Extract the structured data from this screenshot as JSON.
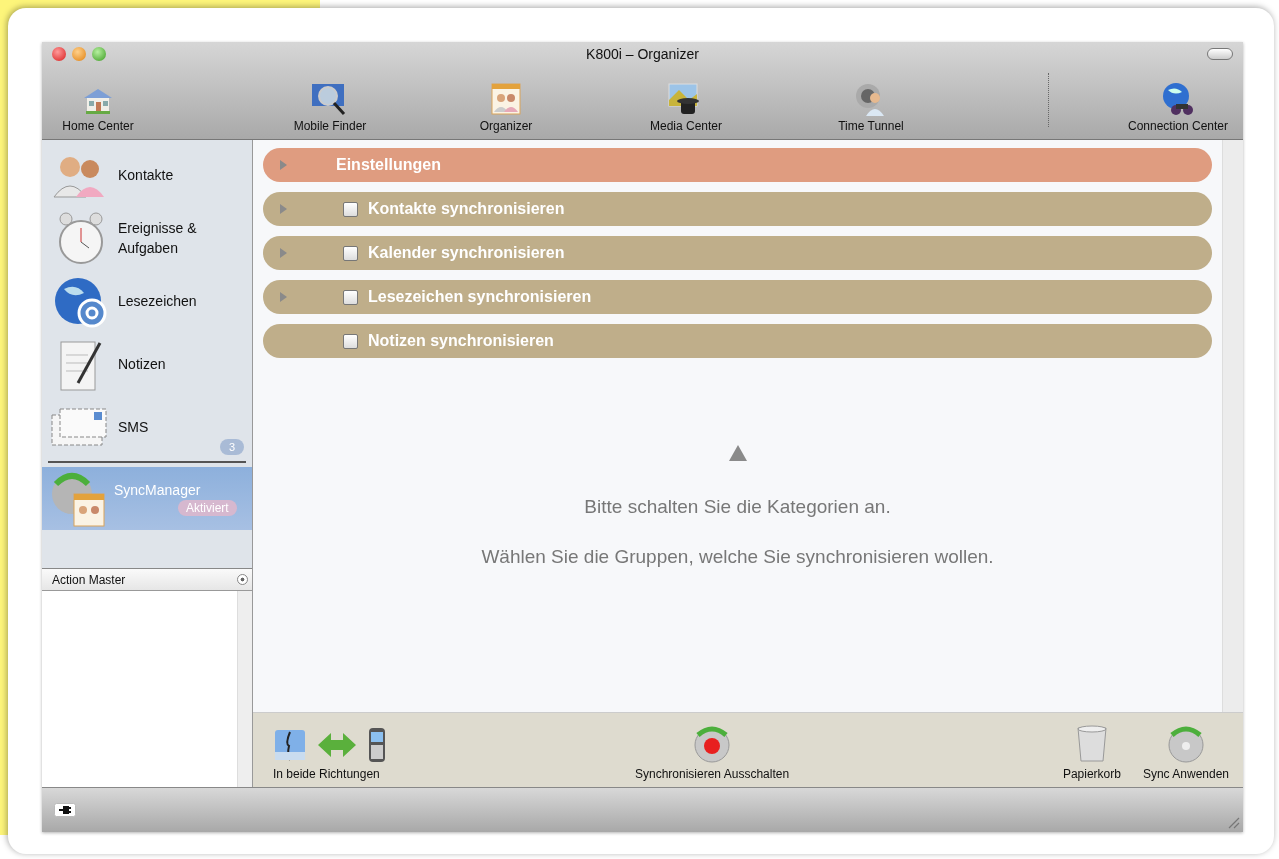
{
  "window": {
    "title": "K800i – Organizer"
  },
  "toolbar": [
    {
      "label": "Home Center",
      "kind": "home"
    },
    {
      "label": "Mobile Finder",
      "kind": "finder"
    },
    {
      "label": "Organizer",
      "kind": "organizer"
    },
    {
      "label": "Media Center",
      "kind": "media"
    },
    {
      "label": "Time Tunnel",
      "kind": "tunnel"
    },
    {
      "label": "Connection Center",
      "kind": "connection"
    }
  ],
  "sidebar": {
    "items": [
      {
        "label": "Kontakte",
        "kind": "contacts",
        "selected": false
      },
      {
        "label": "Ereignisse & Aufgaben",
        "kind": "clock",
        "selected": false
      },
      {
        "label": "Lesezeichen",
        "kind": "bookmarks",
        "selected": false
      },
      {
        "label": "Notizen",
        "kind": "notes",
        "selected": false
      },
      {
        "label": "SMS",
        "kind": "sms",
        "selected": false,
        "badge": "3"
      }
    ],
    "sync_item": {
      "label": "SyncManager",
      "status": "Aktiviert",
      "selected": true
    },
    "action_master": {
      "title": "Action Master"
    }
  },
  "sections": [
    {
      "label": "Einstellungen",
      "kind": "header",
      "expandable": true
    },
    {
      "label": "Kontakte synchronisieren",
      "kind": "category",
      "expandable": true,
      "checked": false
    },
    {
      "label": "Kalender synchronisieren",
      "kind": "category",
      "expandable": true,
      "checked": false
    },
    {
      "label": "Lesezeichen synchronisieren",
      "kind": "category",
      "expandable": true,
      "checked": false
    },
    {
      "label": "Notizen synchronisieren",
      "kind": "category",
      "expandable": false,
      "checked": false
    }
  ],
  "hint": {
    "lines": [
      "Bitte schalten Sie die Kategorien an.",
      "Wählen Sie die Gruppen, welche Sie synchronisieren wollen."
    ]
  },
  "bottom_toolbar": {
    "direction": "In beide Richtungen",
    "center": "Synchronisieren Ausschalten",
    "right": [
      "Papierkorb",
      "Sync Anwenden"
    ]
  }
}
